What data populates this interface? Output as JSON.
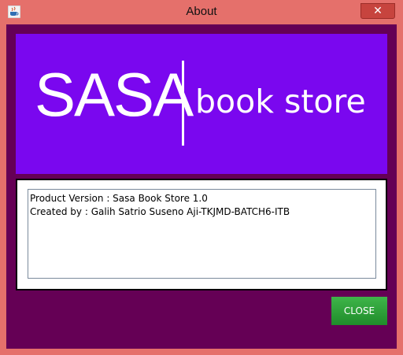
{
  "window": {
    "title": "About",
    "close_glyph": "✕"
  },
  "banner": {
    "logo_primary": "SASA",
    "logo_secondary": "book store",
    "background_color": "#7a07ef"
  },
  "info": {
    "product_version": "Product Version : Sasa Book Store 1.0",
    "created_by": "Created by : Galih Satrio Suseno Aji-TKJMD-BATCH6-ITB"
  },
  "actions": {
    "close_label": "CLOSE",
    "close_color": "#2e9f3a"
  },
  "colors": {
    "content_background": "#650055",
    "window_frame": "#e5706b"
  },
  "icons": {
    "app": "java-coffee-cup-icon"
  }
}
